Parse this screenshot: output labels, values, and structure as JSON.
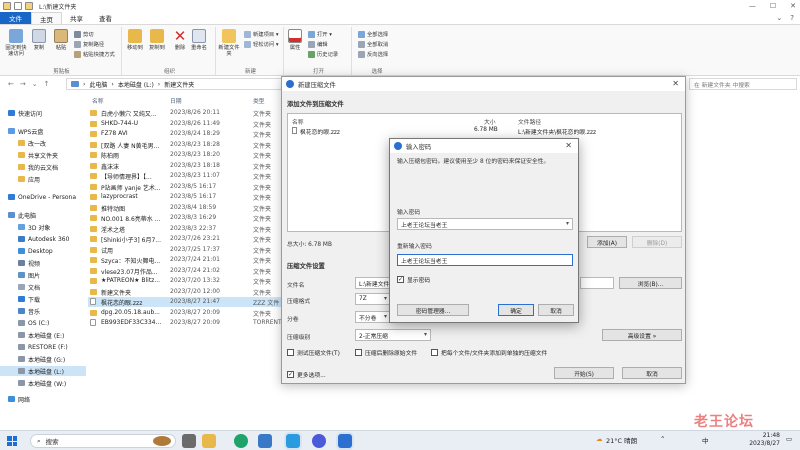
{
  "window": {
    "title": "L:\\新建文件夹"
  },
  "menu": {
    "file": "文件",
    "tabs": [
      "主页",
      "共享",
      "查看"
    ]
  },
  "ribbon": {
    "clipboard": {
      "label": "剪贴板",
      "pin": "固定到快速访问",
      "copy": "复制",
      "paste": "粘贴",
      "cut": "剪切",
      "copy_path": "复制路径",
      "paste_shortcut": "粘贴快捷方式"
    },
    "organize": {
      "label": "组织",
      "move_to": "移动到",
      "copy_to": "复制到",
      "delete": "删除",
      "rename": "重命名"
    },
    "new": {
      "label": "新建",
      "new_folder": "新建文件夹",
      "new_item": "新建项目 ▾",
      "easy_access": "轻松访问 ▾"
    },
    "open": {
      "label": "打开",
      "properties": "属性",
      "open": "打开 ▾",
      "edit": "编辑",
      "history": "历史记录"
    },
    "select": {
      "label": "选择",
      "select_all": "全部选择",
      "select_none": "全部取消",
      "invert": "反向选择"
    }
  },
  "address": {
    "path": [
      "此电脑",
      "本地磁盘 (L:)",
      "新建文件夹"
    ],
    "search_placeholder": "在 新建文件夹 中搜索"
  },
  "sidebar": {
    "items": [
      {
        "label": "快速访问"
      },
      {
        "label": "WPS云盘"
      },
      {
        "label": "改一改"
      },
      {
        "label": "共享文件夹"
      },
      {
        "label": "我的云文档"
      },
      {
        "label": "应用"
      },
      {
        "label": "OneDrive - Persona"
      },
      {
        "label": "此电脑"
      },
      {
        "label": "3D 对象"
      },
      {
        "label": "Autodesk 360"
      },
      {
        "label": "Desktop"
      },
      {
        "label": "视频"
      },
      {
        "label": "图片"
      },
      {
        "label": "文档"
      },
      {
        "label": "下载"
      },
      {
        "label": "音乐"
      },
      {
        "label": "OS (C:)"
      },
      {
        "label": "本地磁盘 (E:)"
      },
      {
        "label": "RESTORE (F:)"
      },
      {
        "label": "本地磁盘 (G:)"
      },
      {
        "label": "本地磁盘 (L:)"
      },
      {
        "label": "本地磁盘 (W:)"
      },
      {
        "label": "网络"
      }
    ]
  },
  "filelist": {
    "headers": {
      "name": "名称",
      "date": "日期",
      "type": "类型"
    },
    "rows": [
      {
        "name": "白虎小懒穴 又纯又...",
        "date": "2023/8/26 20:11",
        "type": "文件夹"
      },
      {
        "name": "SHKD-744-U",
        "date": "2023/8/26 11:49",
        "type": "文件夹"
      },
      {
        "name": "FZ78 AVI",
        "date": "2023/8/24 18:29",
        "type": "文件夹"
      },
      {
        "name": "[双路 人妻 N黄毛男...",
        "date": "2023/8/23 18:28",
        "type": "文件夹"
      },
      {
        "name": "陈柏雨",
        "date": "2023/8/23 18:20",
        "type": "文件夹"
      },
      {
        "name": "鑫沫沫",
        "date": "2023/8/23 18:18",
        "type": "文件夹"
      },
      {
        "name": "【导师情理界】【...",
        "date": "2023/8/23 11:07",
        "type": "文件夹"
      },
      {
        "name": "P站画师 yanje 艺术...",
        "date": "2023/8/5 16:17",
        "type": "文件夹"
      },
      {
        "name": "lazyprocrast",
        "date": "2023/8/5 16:17",
        "type": "文件夹"
      },
      {
        "name": "推特动图",
        "date": "2023/8/4 18:59",
        "type": "文件夹"
      },
      {
        "name": "NO.001 8.6亮蒂水 ...",
        "date": "2023/8/3 16:29",
        "type": "文件夹"
      },
      {
        "name": "淫术之塔",
        "date": "2023/8/3 22:37",
        "type": "文件夹"
      },
      {
        "name": "[Shinki小子3] 6月7...",
        "date": "2023/7/26 23:21",
        "type": "文件夹"
      },
      {
        "name": "试用",
        "date": "2023/7/25 17:37",
        "type": "文件夹"
      },
      {
        "name": "Szyca：不知火舞电...",
        "date": "2023/7/24 21:01",
        "type": "文件夹"
      },
      {
        "name": "vlese23.07月作品...",
        "date": "2023/7/24 21:02",
        "type": "文件夹"
      },
      {
        "name": "★PATREON★ Blitz...",
        "date": "2023/7/20 13:32",
        "type": "文件夹"
      },
      {
        "name": "新建文件夹",
        "date": "2023/7/20 12:00",
        "type": "文件夹"
      },
      {
        "name": "枫花恋的眼.zzz",
        "date": "2023/8/27 21:47",
        "type": "ZZZ 文件",
        "file": true,
        "selected": true
      },
      {
        "name": "dpg.20.05.18.aub...",
        "date": "2023/8/27 20:09",
        "type": "文件夹"
      },
      {
        "name": "EB993EDF33C334...",
        "date": "2023/8/27 20:09",
        "type": "TORRENT",
        "file": true
      }
    ]
  },
  "zip_dialog": {
    "title": "新建压缩文件",
    "add_section": "添加文件到压缩文件",
    "list_headers": {
      "name": "名称",
      "size": "大小",
      "path": "文件路径"
    },
    "file": {
      "name": "枫花恋的眼.zzz",
      "size": "6.78 MB",
      "path": "L:\\新建文件夹\\枫花恋的眼.zzz"
    },
    "total": "总大小: 6.78 MB",
    "add_button": "添加(A)",
    "delete_button": "删除(D)",
    "settings_section": "压缩文件设置",
    "filename_label": "文件名",
    "filename_value": "L:\\新建文件夹\\",
    "browse_button": "浏览(B)...",
    "format_label": "压缩格式",
    "format_value": "7Z",
    "split_label": "分卷",
    "split_value": "不分卷",
    "level_label": "压缩级别",
    "level_value": "2-正常压缩",
    "advanced_button": "高级设置 »",
    "test_cb": "测试压缩文件(T)",
    "delete_after_cb": "压缩后删除原始文件",
    "each_file_cb": "把每个文件/文件夹添加到单独的压缩文件",
    "more_options": "更多选项...",
    "start_button": "开始(S)",
    "cancel_button": "取消"
  },
  "password_dialog": {
    "title": "输入密码",
    "hint": "输入压缩包密码。建议使用至少 8 位的密码来保证安全性。",
    "password_label": "输入密码",
    "password_value": "上老王论坛当老王",
    "repeat_label": "重新输入密码",
    "repeat_value": "上老王论坛当老王",
    "show_password": "显示密码",
    "manager_button": "密码管理器...",
    "ok_button": "确定",
    "cancel_button": "取消"
  },
  "taskbar": {
    "search": "搜索",
    "weather": "21°C 晴朗",
    "lang": "中",
    "time": "21:48",
    "date": "2023/8/27"
  },
  "watermark": "老王论坛",
  "colors": {
    "accent": "#1a66c6",
    "selection": "#cce4f7",
    "folder": "#e8b84a"
  }
}
